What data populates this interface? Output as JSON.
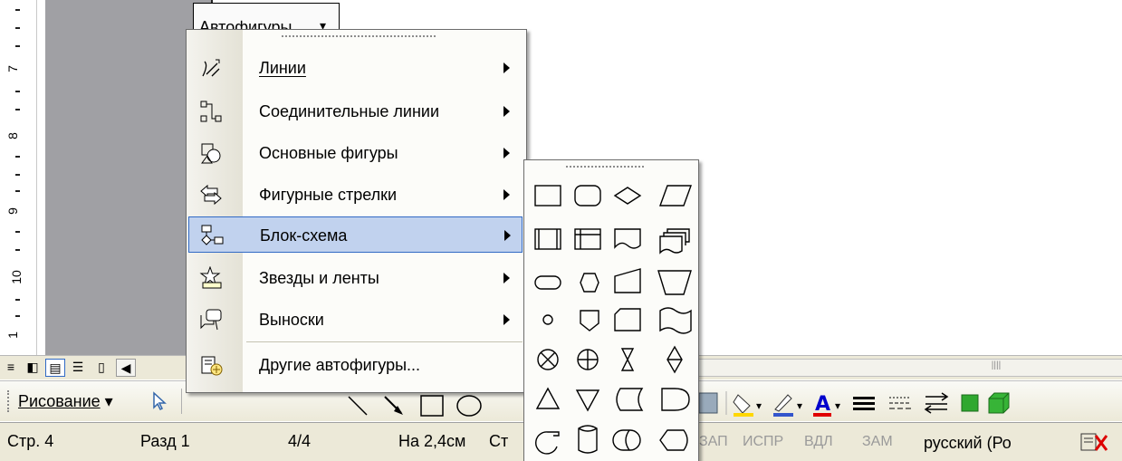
{
  "ruler": {
    "numbers": [
      "7",
      "8",
      "9",
      "10",
      "1"
    ]
  },
  "autoshapes_menu": {
    "items": [
      {
        "label": "Линии",
        "icon": "lines-icon",
        "submenu": true
      },
      {
        "label": "Соединительные линии",
        "icon": "connectors-icon",
        "submenu": true
      },
      {
        "label": "Основные фигуры",
        "icon": "basic-shapes-icon",
        "submenu": true
      },
      {
        "label": "Фигурные стрелки",
        "icon": "block-arrows-icon",
        "submenu": true
      },
      {
        "label": "Блок-схема",
        "icon": "flowchart-icon",
        "submenu": true,
        "highlighted": true
      },
      {
        "label": "Звезды и ленты",
        "icon": "stars-banners-icon",
        "submenu": true
      },
      {
        "label": "Выноски",
        "icon": "callouts-icon",
        "submenu": true
      },
      {
        "label": "Другие автофигуры...",
        "icon": "more-autoshapes-icon",
        "submenu": false
      }
    ]
  },
  "flowchart_submenu": {
    "shapes": [
      "process",
      "alternate-process",
      "decision",
      "data",
      "predefined-process",
      "internal-storage",
      "document",
      "multidocument",
      "terminator",
      "preparation",
      "manual-input",
      "manual-operation",
      "connector",
      "off-page-connector",
      "card",
      "punched-tape",
      "summing-junction",
      "or",
      "collate",
      "sort",
      "extract",
      "merge",
      "stored-data",
      "delay",
      "sequential-access-storage",
      "magnetic-disk",
      "direct-access-storage",
      "display"
    ]
  },
  "drawing_toolbar": {
    "draw_label": "Рисование",
    "autoshapes_label": "Автофигуры",
    "accent_color": "#316ac5",
    "font_color_bar": "#e00000"
  },
  "status_bar": {
    "page": "Стр. 4",
    "section": "Разд 1",
    "pages": "4/4",
    "position": "На 2,4см",
    "line": "Ст",
    "rec": "ЗАП",
    "trk": "ИСПР",
    "ext": "ВДЛ",
    "ovr": "ЗАМ",
    "language": "русский (Ро"
  }
}
